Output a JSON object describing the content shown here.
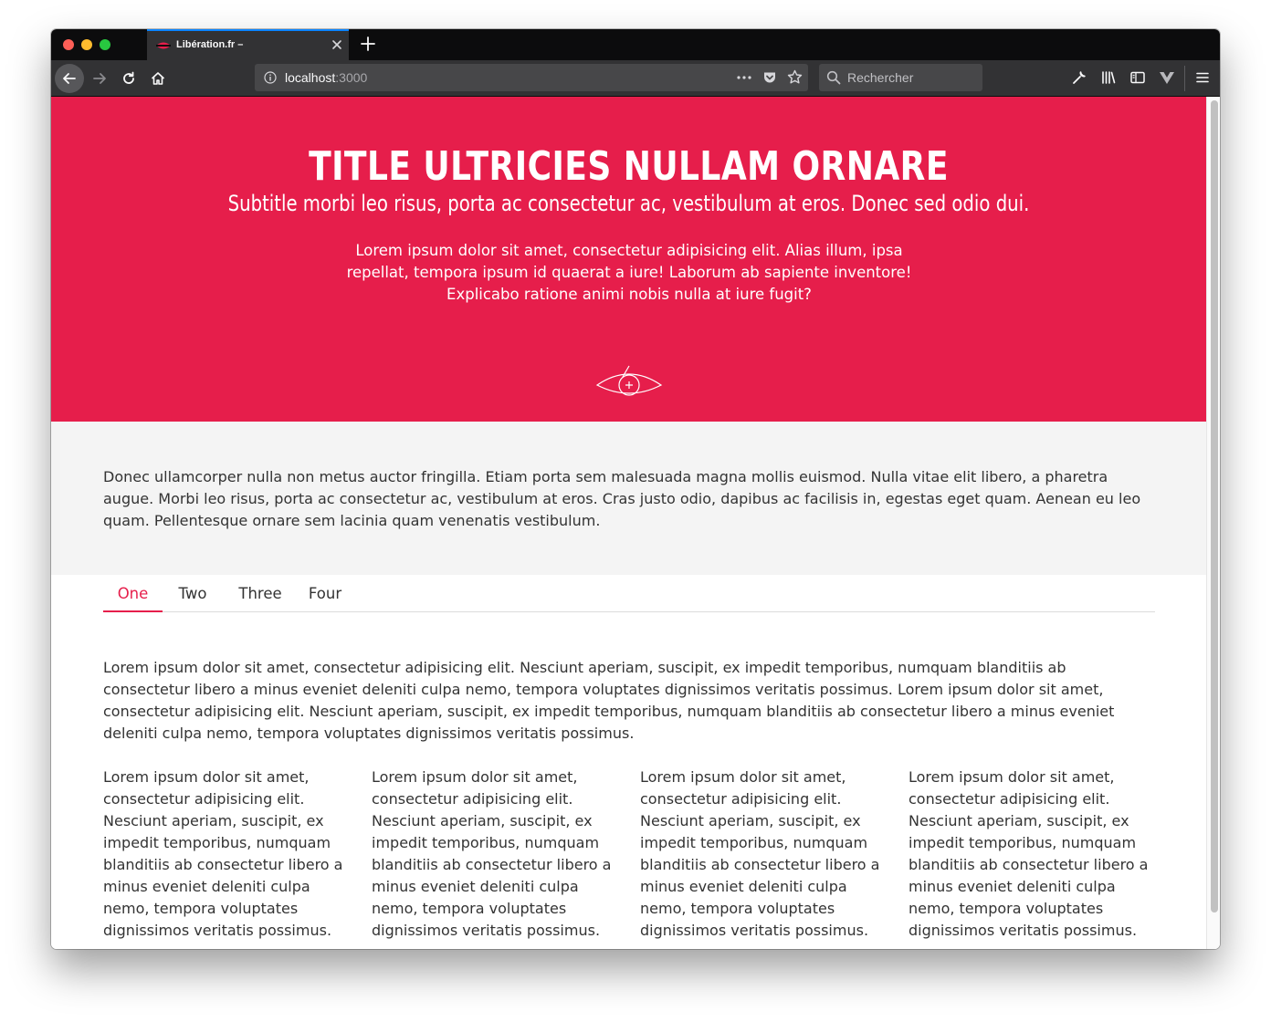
{
  "browser": {
    "tab_title": "Libération.fr –",
    "url_host": "localhost",
    "url_port": ":3000",
    "search_placeholder": "Rechercher",
    "colors": {
      "tabstrip": "#0c0c0d",
      "toolbar": "#323234",
      "active_tab_accent": "#0a84ff"
    }
  },
  "hero": {
    "title": "TITLE ULTRICIES NULLAM ORNARE",
    "subtitle": "Subtitle morbi leo risus, porta ac consectetur ac, vestibulum at eros. Donec sed odio dui.",
    "text": "Lorem ipsum dolor sit amet, consectetur adipisicing elit. Alias illum, ipsa repellat, tempora ipsum id quaerat a iure! Laborum ab sapiente inventore! Explicabo ratione animi nobis nulla at iure fugit?",
    "icon": "eye-icon",
    "color": "#e61e4b"
  },
  "intro": {
    "text": "Donec ullamcorper nulla non metus auctor fringilla. Etiam porta sem malesuada magna mollis euismod. Nulla vitae elit libero, a pharetra augue. Morbi leo risus, porta ac consectetur ac, vestibulum at eros. Cras justo odio, dapibus ac facilisis in, egestas eget quam. Aenean eu leo quam. Pellentesque ornare sem lacinia quam venenatis vestibulum."
  },
  "tabs": {
    "items": [
      {
        "label": "One",
        "active": true
      },
      {
        "label": "Two",
        "active": false
      },
      {
        "label": "Three",
        "active": false
      },
      {
        "label": "Four",
        "active": false
      }
    ]
  },
  "content": {
    "paragraph": "Lorem ipsum dolor sit amet, consectetur adipisicing elit. Nesciunt aperiam, suscipit, ex impedit temporibus, numquam blanditiis ab consectetur libero a minus eveniet deleniti culpa nemo, tempora voluptates dignissimos veritatis possimus. Lorem ipsum dolor sit amet, consectetur adipisicing elit. Nesciunt aperiam, suscipit, ex impedit temporibus, numquam blanditiis ab consectetur libero a minus eveniet deleniti culpa nemo, tempora voluptates dignissimos veritatis possimus.",
    "columns": [
      "Lorem ipsum dolor sit amet, consectetur adipisicing elit. Nesciunt aperiam, suscipit, ex impedit temporibus, numquam blanditiis ab consectetur libero a minus eveniet deleniti culpa nemo, tempora voluptates dignissimos veritatis possimus.",
      "Lorem ipsum dolor sit amet, consectetur adipisicing elit. Nesciunt aperiam, suscipit, ex impedit temporibus, numquam blanditiis ab consectetur libero a minus eveniet deleniti culpa nemo, tempora voluptates dignissimos veritatis possimus.",
      "Lorem ipsum dolor sit amet, consectetur adipisicing elit. Nesciunt aperiam, suscipit, ex impedit temporibus, numquam blanditiis ab consectetur libero a minus eveniet deleniti culpa nemo, tempora voluptates dignissimos veritatis possimus.",
      "Lorem ipsum dolor sit amet, consectetur adipisicing elit. Nesciunt aperiam, suscipit, ex impedit temporibus, numquam blanditiis ab consectetur libero a minus eveniet deleniti culpa nemo, tempora voluptates dignissimos veritatis possimus."
    ]
  }
}
